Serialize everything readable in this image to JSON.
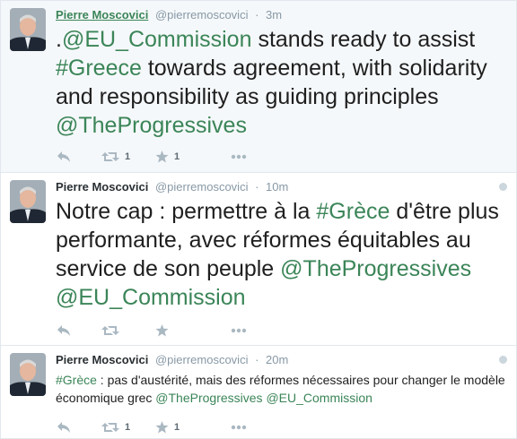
{
  "tweets": [
    {
      "name": "Pierre Moscovici",
      "handle": "@pierremoscovici",
      "separator": "·",
      "time": "3m",
      "text_parts": [
        {
          "t": ".",
          "link": false
        },
        {
          "t": "@EU_Commission",
          "link": true
        },
        {
          "t": " stands ready to assist ",
          "link": false
        },
        {
          "t": "#Greece",
          "link": true
        },
        {
          "t": " towards agreement, with solidarity and responsibility as guiding principles ",
          "link": false
        },
        {
          "t": "@TheProgressives",
          "link": true
        }
      ],
      "retweets": "1",
      "favorites": "1"
    },
    {
      "name": "Pierre Moscovici",
      "handle": "@pierremoscovici",
      "separator": "·",
      "time": "10m",
      "text_parts": [
        {
          "t": "Notre cap : permettre à la ",
          "link": false
        },
        {
          "t": "#Grèce",
          "link": true
        },
        {
          "t": " d'être plus performante, avec réformes équitables au service de son peuple ",
          "link": false
        },
        {
          "t": "@TheProgressives",
          "link": true
        },
        {
          "t": " ",
          "link": false
        },
        {
          "t": "@EU_Commission",
          "link": true
        }
      ],
      "retweets": "",
      "favorites": ""
    },
    {
      "name": "Pierre Moscovici",
      "handle": "@pierremoscovici",
      "separator": "·",
      "time": "20m",
      "text_parts": [
        {
          "t": "#Grèce",
          "link": true
        },
        {
          "t": " : pas d'austérité, mais des réformes nécessaires pour changer le modèle économique grec ",
          "link": false
        },
        {
          "t": "@TheProgressives",
          "link": true
        },
        {
          "t": " ",
          "link": false
        },
        {
          "t": "@EU_Commission",
          "link": true
        }
      ],
      "retweets": "1",
      "favorites": "1"
    }
  ],
  "icons": {
    "reply": "reply-icon",
    "retweet": "retweet-icon",
    "favorite": "star-icon",
    "more": "more-icon",
    "globe": "globe-icon"
  },
  "colors": {
    "link": "#3b8558",
    "meta": "#8899a6",
    "icon": "#aab8c2",
    "highlight_bg": "#f5f8fa"
  }
}
